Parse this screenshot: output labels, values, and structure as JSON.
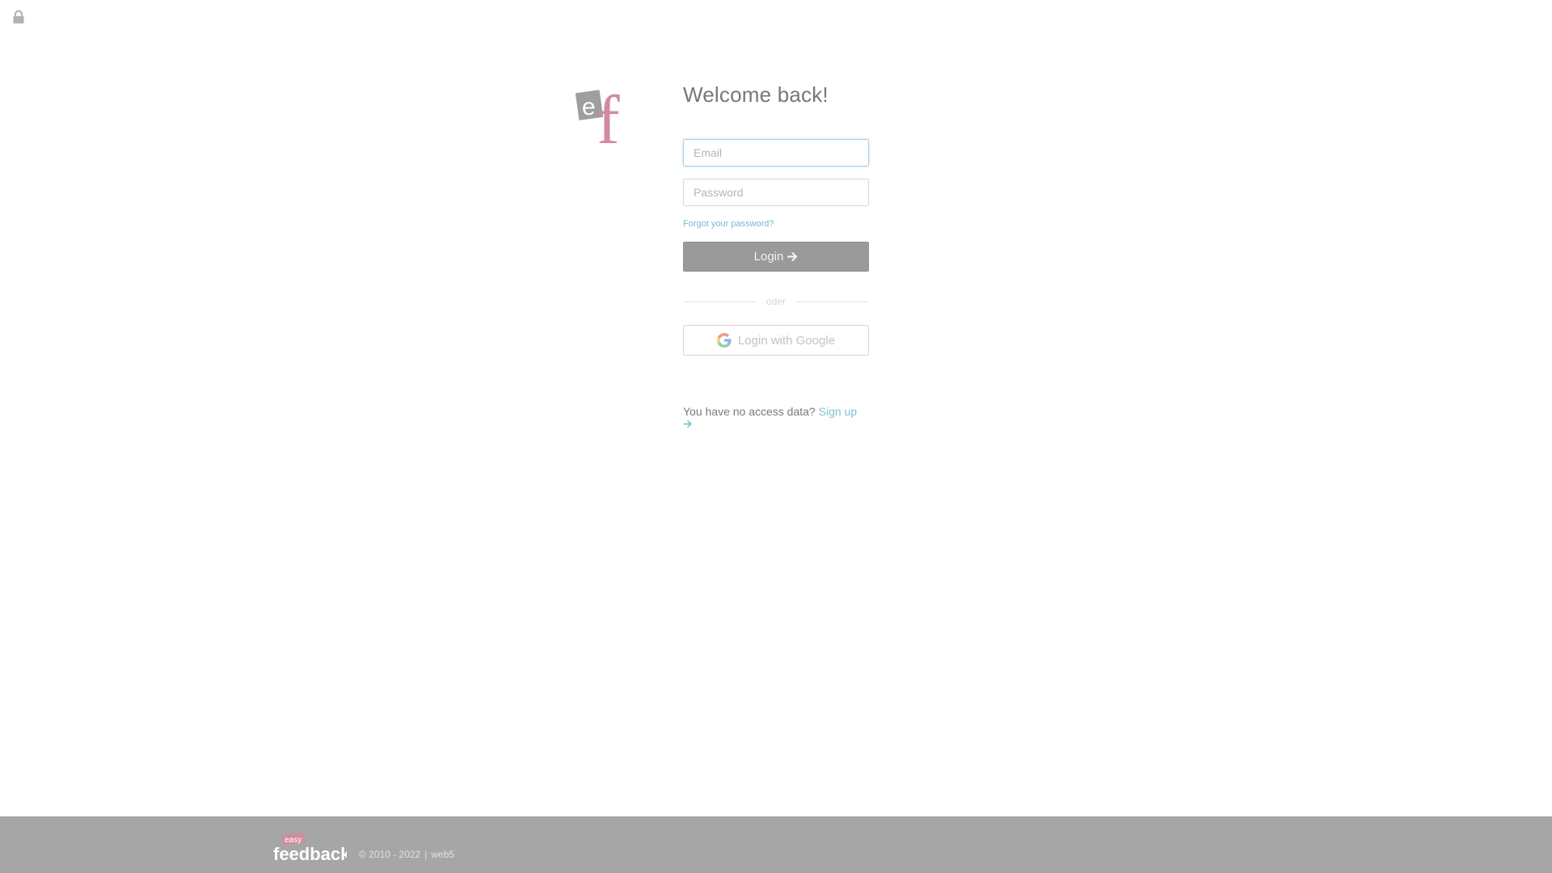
{
  "icons": {
    "lock": "lock-icon",
    "arrow": "arrow-right-icon",
    "google": "google-icon"
  },
  "logo": {
    "letters": [
      "e",
      "f"
    ]
  },
  "login": {
    "heading": "Welcome back!",
    "email_placeholder": "Email",
    "email_value": "",
    "password_placeholder": "Password",
    "password_value": "",
    "forgot_label": "Forgot your password?",
    "login_label": "Login",
    "divider_text": "oder",
    "google_label": "Login with Google",
    "signup_prompt": "You have no access data?",
    "signup_label": "Sign up"
  },
  "footer": {
    "brand_small": "easy",
    "brand": "feedback",
    "copyright": "© 2010 - 2022",
    "separator": "|",
    "server": "web5"
  },
  "colors": {
    "footer_bg": "#a6a6a6",
    "login_button_bg": "#9a9a9a",
    "link": "#7ec4cf",
    "logo_e": "#9e9e9e",
    "logo_f": "#d38a9c"
  }
}
